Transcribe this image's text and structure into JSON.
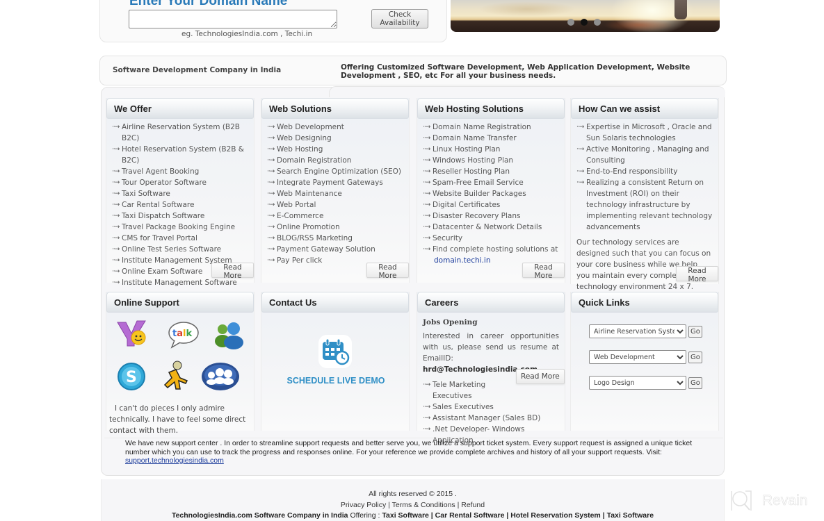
{
  "domain_search": {
    "title": "Enter Your Domain Name",
    "input_value": "",
    "hint": "eg. TechnologiesIndia.com , Techi.in",
    "check_button": "Check Availability"
  },
  "banner": {
    "slide_count": 3,
    "active_slide": 2
  },
  "tagline": {
    "left": "Software Development Company in India",
    "right": "Offering Customized Software Development, Web Application Development, Website Development , SEO, etc For all your business needs."
  },
  "panels": {
    "we_offer": {
      "title": "We Offer",
      "items": [
        "Airline Reservation System (B2B B2C)",
        "Hotel Reservation System (B2B & B2C)",
        "Travel Agent Booking",
        "Tour Operator Software",
        "Taxi Software",
        "Car Rental Software",
        "Taxi Dispatch Software",
        "Travel Package Booking Engine",
        "CMS for Travel Portal",
        "Online Test Series Software",
        "Institute Management System",
        "Online Exam Software",
        "Institute Management Software"
      ],
      "read_more": "Read More"
    },
    "web_solutions": {
      "title": "Web Solutions",
      "items": [
        "Web Development",
        "Web Designing",
        "Web Hosting",
        "Domain Registration",
        "Search Engine Optimization (SEO)",
        "Integrate Payment Gateways",
        "Web Maintenance",
        "Web Portal",
        "E-Commerce",
        "Online Promotion",
        "BLOG/RSS Marketing",
        "Payment Gateway Solution",
        "Pay Per click"
      ],
      "read_more": "Read More"
    },
    "web_hosting": {
      "title": "Web Hosting Solutions",
      "items": [
        "Domain Name Registration",
        "Domain Name Transfer",
        "Linux Hosting Plan",
        "Windows Hosting Plan",
        "Reseller Hosting Plan",
        "Spam-Free Email Service",
        "Website Builder Packages",
        "Digital Certificates",
        "Disaster Recovery Plans",
        "Datacenter & Network Details",
        "Security",
        "Find complete hosting solutions at"
      ],
      "link": "domain.techi.in",
      "read_more": "Read More"
    },
    "assist": {
      "title": "How Can we assist",
      "items": [
        "Expertise in Microsoft , Oracle and Sun Solaris technologies",
        "Active Monitoring , Managing and Consulting",
        "End-to-End responsibility",
        "Realizing a consistent Return on Investment (ROI) on their technology infrastructure by implementing relevant technology advancements"
      ],
      "paragraph": "Our technology services are designed such that you can focus on your core business while we help you maintain every complex technology environment 24 x 7.",
      "read_more": "Read More"
    },
    "online_support": {
      "title": "Online Support",
      "icons": [
        "yahoo-messenger-icon",
        "google-talk-icon",
        "msn-messenger-icon",
        "skype-icon",
        "aim-icon",
        "group-chat-icon"
      ],
      "quote": "I can't do pieces I only admire technically. I have to feel some direct contact with them."
    },
    "contact": {
      "title": "Contact Us",
      "demo_label": "SCHEDULE LIVE DEMO"
    },
    "careers": {
      "title": "Careers",
      "subtitle": "Jobs Opening",
      "text": "Interested in career opportunities with us, please send us resume at EmailID:",
      "email": "hrd@Technologiesindia.com",
      "jobs": [
        "Tele Marketing Executives",
        "Sales Executives",
        "Assistant Manager (Sales BD)",
        ".Net Developer- Windows Application"
      ],
      "read_more": "Read More"
    },
    "quick_links": {
      "title": "Quick Links",
      "selects": [
        {
          "value": "Airline Reservation System (B2B B2C)"
        },
        {
          "value": "Web Development"
        },
        {
          "value": "Logo Design"
        }
      ],
      "go_label": "Go"
    }
  },
  "support_notice": {
    "text": "We have new support center . In order to streamline support requests and better serve you, we utilize a support ticket system. Every support request is assigned a unique ticket number which you can use to track the progress and responses online. For your reference we provide complete archives and history of all your support requests. Visit:",
    "link": "support.technologiesindia.com"
  },
  "footer": {
    "copyright": "All rights reserved © 2015 .",
    "links": [
      "Privacy Policy",
      "Terms & Conditions",
      "Refund"
    ],
    "company": "TechnologiesIndia.com Software Company in India",
    "offering_label": "Offering :",
    "offerings": [
      "Taxi Software",
      "Car Rental Software",
      "Hotel Reservation System",
      "Taxi Software"
    ]
  },
  "watermark": {
    "text": "Revain"
  }
}
